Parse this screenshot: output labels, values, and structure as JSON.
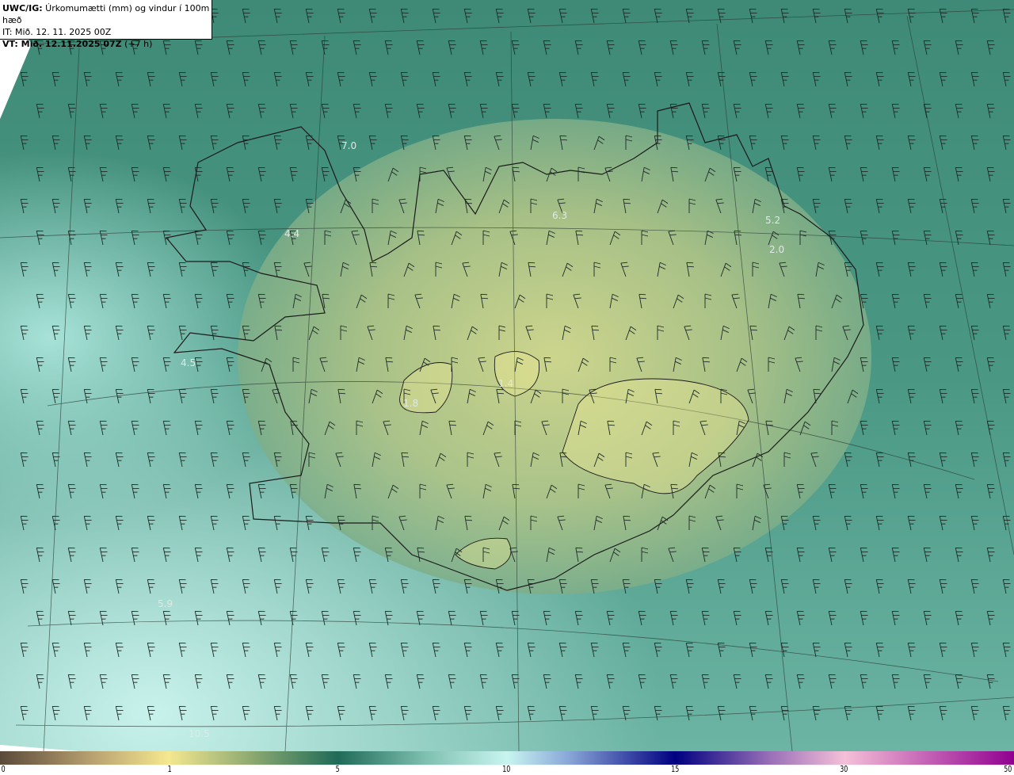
{
  "header": {
    "title_bold": "UWC/IG:",
    "title": " Úrkomumætti (mm) og vindur í 100m hæð",
    "init_time": "IT: Mið. 12. 11. 2025 00Z",
    "valid_bold": "VT: Mið. 12.11.2025 07Z",
    "valid_offset": " (+7 h)"
  },
  "map_labels": [
    "7.0",
    "4.4",
    "6.3",
    "5.2",
    "2.0",
    "4.5",
    "5.9",
    "10.5",
    "1.8",
    "1.4"
  ],
  "colorbar": {
    "ticks": [
      "0",
      "1",
      "5",
      "10",
      "15",
      "30",
      "50"
    ],
    "colors": [
      "#5a4a3a",
      "#f5e890",
      "#1f6b58",
      "#c8f5f0",
      "#000080",
      "#f5c0d8",
      "#900090"
    ]
  }
}
